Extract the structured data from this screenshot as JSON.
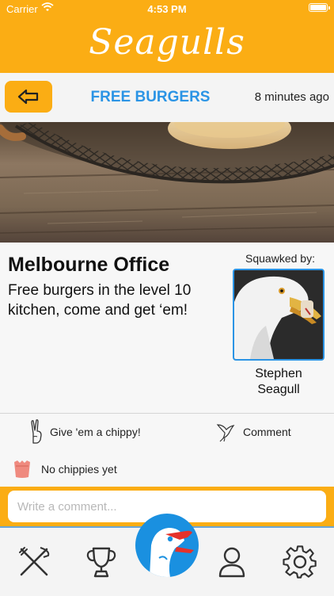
{
  "status_bar": {
    "carrier": "Carrier",
    "time": "4:53 PM"
  },
  "app": {
    "logo_text": "Seagulls",
    "brand_color": "#fbad14",
    "accent_color": "#2b94e5"
  },
  "header": {
    "back_icon": "back-arrow-icon",
    "title": "FREE BURGERS",
    "time_ago": "8 minutes ago"
  },
  "post": {
    "location": "Melbourne Office",
    "message": "Free burgers in the level 10 kitchen, come and get ‘em!",
    "squawked_by_label": "Squawked by:",
    "author_first": "Stephen",
    "author_last": "Seagull"
  },
  "actions": {
    "chippy_label": "Give 'em a chippy!",
    "chippy_icon": "hand-peace-icon",
    "comment_label": "Comment",
    "comment_icon": "seagull-icon"
  },
  "chippies": {
    "status": "No chippies yet",
    "icon": "chip-bag-icon"
  },
  "comment": {
    "placeholder": "Write a comment..."
  },
  "tabs": [
    {
      "name": "food",
      "icon": "fork-knife-icon"
    },
    {
      "name": "leaderboard",
      "icon": "trophy-icon"
    },
    {
      "name": "home",
      "icon": "seagull-head-icon"
    },
    {
      "name": "profile",
      "icon": "user-icon"
    },
    {
      "name": "settings",
      "icon": "gear-icon"
    }
  ]
}
